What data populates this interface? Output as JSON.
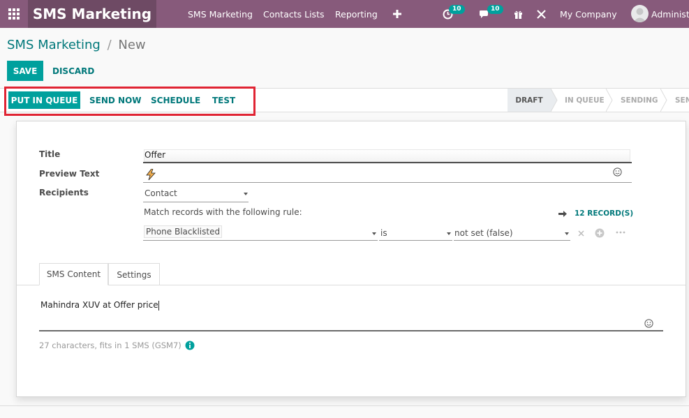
{
  "navbar": {
    "app_name": "SMS Marketing",
    "menu": [
      {
        "label": "SMS Marketing"
      },
      {
        "label": "Contacts Lists"
      },
      {
        "label": "Reporting"
      }
    ],
    "activity_badge": "10",
    "messages_badge": "10",
    "company": "My Company",
    "user": "Administr"
  },
  "breadcrumb": {
    "parent": "SMS Marketing",
    "separator": "/",
    "current": "New"
  },
  "actions": {
    "save": "SAVE",
    "discard": "DISCARD"
  },
  "statusbar": {
    "buttons": {
      "queue": "PUT IN QUEUE",
      "send_now": "SEND NOW",
      "schedule": "SCHEDULE",
      "test": "TEST"
    },
    "stages": [
      {
        "label": "DRAFT",
        "active": true
      },
      {
        "label": "IN QUEUE",
        "active": false
      },
      {
        "label": "SENDING",
        "active": false
      },
      {
        "label": "SEN",
        "active": false
      }
    ]
  },
  "form": {
    "title_label": "Title",
    "title_value": "Offer",
    "preview_label": "Preview Text",
    "recipients_label": "Recipients",
    "recipients_value": "Contact",
    "rule_text": "Match records with the following rule:",
    "records_link": "12 RECORD(S)",
    "rule": {
      "field": "Phone Blacklisted",
      "operator": "is",
      "value": "not set (false)"
    }
  },
  "tabs": [
    {
      "label": "SMS Content",
      "active": true
    },
    {
      "label": "Settings",
      "active": false
    }
  ],
  "sms": {
    "body": "Mahindra XUV at Offer price",
    "count_text": "27 characters, fits in 1 SMS (GSM7)"
  },
  "colors": {
    "navbar": "#875a7b",
    "brand": "#6e4a64",
    "accent": "#00a09d",
    "link": "#00787a",
    "highlight": "#e02433"
  }
}
